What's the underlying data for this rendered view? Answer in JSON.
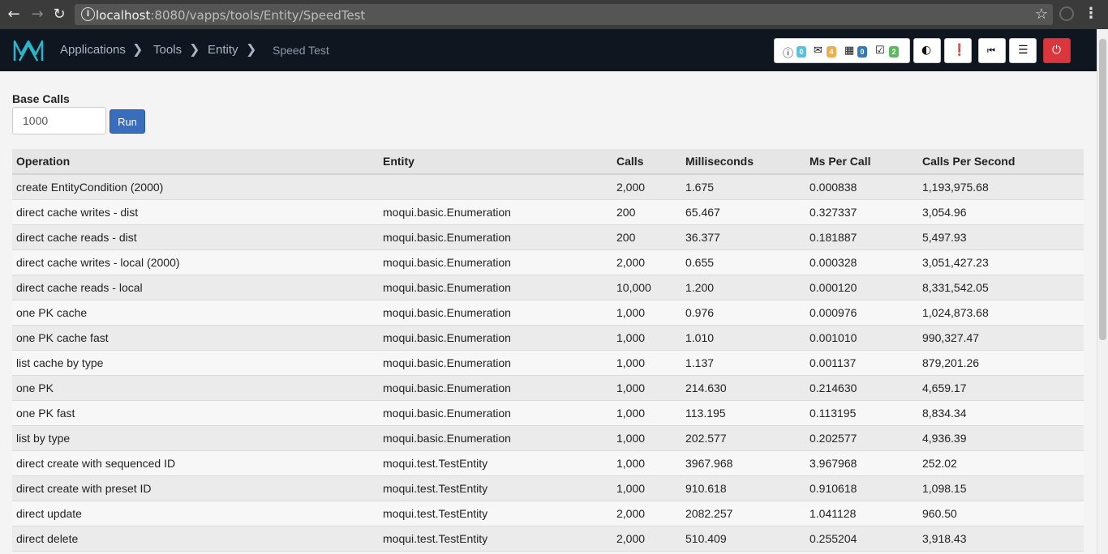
{
  "browser": {
    "url_host": "localhost",
    "url_rest": ":8080/vapps/tools/Entity/SpeedTest",
    "icons": {
      "back": "back-arrow-icon",
      "forward": "forward-arrow-icon",
      "reload": "reload-icon",
      "star": "star-icon",
      "menu": "kebab-menu-icon"
    }
  },
  "header": {
    "breadcrumbs": [
      "Applications",
      "Tools",
      "Entity"
    ],
    "current": "Speed Test",
    "notifications": [
      {
        "icon": "info-icon",
        "count": "0",
        "color": "#5bc0de"
      },
      {
        "icon": "envelope-icon",
        "count": "4",
        "color": "#f0ad4e"
      },
      {
        "icon": "calendar-icon",
        "count": "0",
        "color": "#337ab7"
      },
      {
        "icon": "task-check-icon",
        "count": "2",
        "color": "#5cb85c"
      }
    ],
    "accent_danger": "#d9363e"
  },
  "form": {
    "base_calls_label": "Base Calls",
    "base_calls_value": "1000",
    "run_label": "Run"
  },
  "table": {
    "headers": [
      "Operation",
      "Entity",
      "Calls",
      "Milliseconds",
      "Ms Per Call",
      "Calls Per Second"
    ],
    "rows": [
      [
        "create EntityCondition (2000)",
        "",
        "2,000",
        "1.675",
        "0.000838",
        "1,193,975.68"
      ],
      [
        "direct cache writes - dist",
        "moqui.basic.Enumeration",
        "200",
        "65.467",
        "0.327337",
        "3,054.96"
      ],
      [
        "direct cache reads - dist",
        "moqui.basic.Enumeration",
        "200",
        "36.377",
        "0.181887",
        "5,497.93"
      ],
      [
        "direct cache writes - local (2000)",
        "moqui.basic.Enumeration",
        "2,000",
        "0.655",
        "0.000328",
        "3,051,427.23"
      ],
      [
        "direct cache reads - local",
        "moqui.basic.Enumeration",
        "10,000",
        "1.200",
        "0.000120",
        "8,331,542.05"
      ],
      [
        "one PK cache",
        "moqui.basic.Enumeration",
        "1,000",
        "0.976",
        "0.000976",
        "1,024,873.68"
      ],
      [
        "one PK cache fast",
        "moqui.basic.Enumeration",
        "1,000",
        "1.010",
        "0.001010",
        "990,327.47"
      ],
      [
        "list cache by type",
        "moqui.basic.Enumeration",
        "1,000",
        "1.137",
        "0.001137",
        "879,201.26"
      ],
      [
        "one PK",
        "moqui.basic.Enumeration",
        "1,000",
        "214.630",
        "0.214630",
        "4,659.17"
      ],
      [
        "one PK fast",
        "moqui.basic.Enumeration",
        "1,000",
        "113.195",
        "0.113195",
        "8,834.34"
      ],
      [
        "list by type",
        "moqui.basic.Enumeration",
        "1,000",
        "202.577",
        "0.202577",
        "4,936.39"
      ],
      [
        "direct create with sequenced ID",
        "moqui.test.TestEntity",
        "1,000",
        "3967.968",
        "3.967968",
        "252.02"
      ],
      [
        "direct create with preset ID",
        "moqui.test.TestEntity",
        "1,000",
        "910.618",
        "0.910618",
        "1,098.15"
      ],
      [
        "direct update",
        "moqui.test.TestEntity",
        "2,000",
        "2082.257",
        "1.041128",
        "960.50"
      ],
      [
        "direct delete",
        "moqui.test.TestEntity",
        "2,000",
        "510.409",
        "0.255204",
        "3,918.43"
      ]
    ]
  }
}
